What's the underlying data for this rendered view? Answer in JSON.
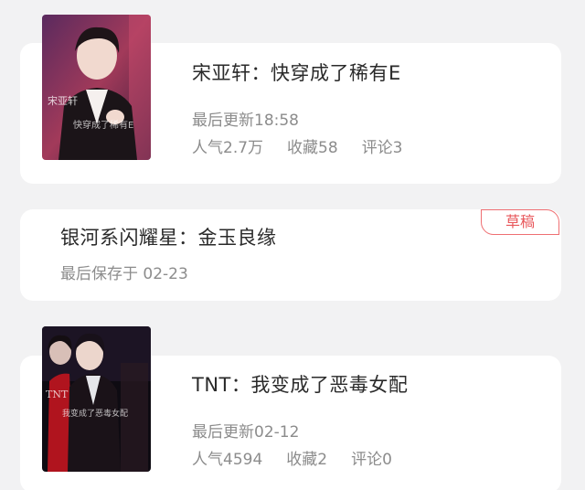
{
  "works": [
    {
      "title": "宋亚轩：快穿成了稀有E",
      "cover_text": "宋亚轩 快穿成了稀有E",
      "update_label": "最后更新18:58",
      "stats": {
        "popularity": "人气2.7万",
        "favorites": "收藏58",
        "comments": "评论3"
      }
    },
    {
      "title": "银河系闪耀星：金玉良缘",
      "badge": "草稿",
      "save_label": "最后保存于 02-23"
    },
    {
      "title": "TNT：我变成了恶毒女配",
      "cover_text": "TNT 我变成了恶毒女配",
      "update_label": "最后更新02-12",
      "stats": {
        "popularity": "人气4594",
        "favorites": "收藏2",
        "comments": "评论0"
      }
    }
  ],
  "colors": {
    "background": "#f2f2f3",
    "card": "#ffffff",
    "badge_accent": "#e8575b"
  }
}
